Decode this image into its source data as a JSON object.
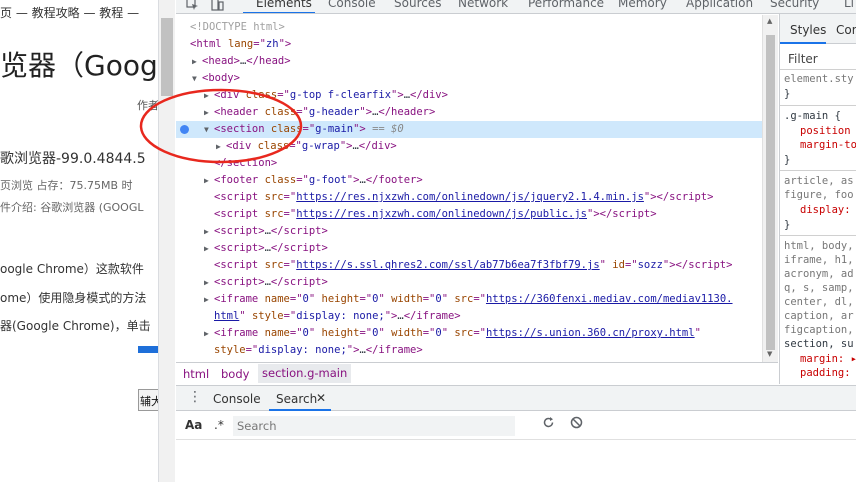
{
  "webpage": {
    "breadcrumb": "页 — 教程攻略 — 教程 —",
    "title": "览器（Googl",
    "author_prefix": "作者",
    "product_name": "歌浏览器-99.0.4844.5",
    "meta_line1": "页浏览    占存：75.75MB    时",
    "meta_line2": "件介绍:   谷歌浏览器 (GOOGL",
    "paragraphs": [
      "oogle Chrome）这款软件",
      "ome）使用隐身模式的方法",
      "器(Google Chrome)，单击"
    ],
    "button_label": "辅大"
  },
  "devtools": {
    "tabs": [
      "Elements",
      "Console",
      "Sources",
      "Network",
      "Performance",
      "Memory",
      "Application",
      "Security",
      "Li"
    ],
    "active_tab": "Elements",
    "tree": {
      "doctype": "<!DOCTYPE html>",
      "html_tag": "html",
      "html_lang_attr": "lang",
      "html_lang_val": "zh",
      "head": "head",
      "head_ellipsis": "…",
      "body": "body",
      "div_gtop_class": "g-top f-clearfix",
      "header_class": "g-header",
      "section_class": "g-main",
      "selected_marker": "== $0",
      "div_gwrap_class": "g-wrap",
      "footer_class": "g-foot",
      "script1_src": "https://res.njxzwh.com/onlinedown/js/jquery2.1.4.min.js",
      "script2_src": "https://res.njxzwh.com/onlinedown/js/public.js",
      "script5_src": "https://s.ssl.qhres2.com/ssl/ab77b6ea7f3fbf79.js",
      "script5_id": "sozz",
      "iframe1_src": "https://360fenxi.mediav.com/mediav1130.html",
      "iframe1_src_a": "https://360fenxi.mediav.com/mediav1130.",
      "iframe1_src_b": "html",
      "iframe2_src": "https://s.union.360.cn/proxy.html",
      "iframe_name": "0",
      "iframe_height": "0",
      "iframe_width": "0",
      "iframe_style": "display: none;"
    },
    "breadcrumb": [
      "html",
      "body",
      "section.g-main"
    ],
    "styles_tabs": [
      "Styles",
      "Com"
    ],
    "styles_filter_placeholder": "Filter",
    "styles_rules": [
      "element.sty",
      "}",
      ".g-main {",
      "position",
      "margin-to",
      "}",
      "article, as",
      "figure, foo",
      "display:",
      "}",
      "html, body,",
      "iframe, h1,",
      "acronym, ad",
      "q, s, samp,",
      "center, dl,",
      "caption, ar",
      "figcaption,",
      "section, su",
      "margin: ▸",
      "padding:"
    ],
    "drawer_tabs": [
      "Console",
      "Search"
    ],
    "active_drawer_tab": "Search",
    "search": {
      "case_label": "Aa",
      "regex_label": ".*",
      "placeholder": "Search"
    }
  }
}
